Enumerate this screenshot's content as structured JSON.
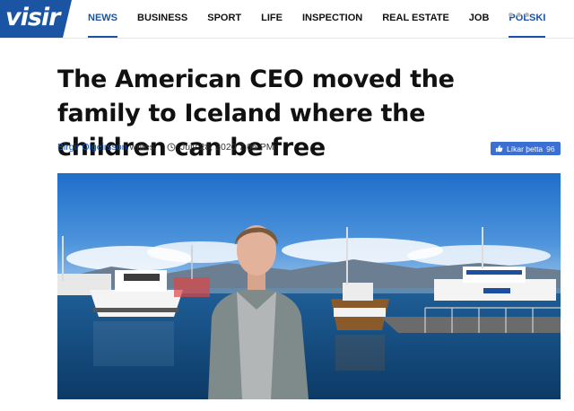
{
  "brand": {
    "logo_text": "visir",
    "color": "#1a54a3"
  },
  "nav": {
    "items": [
      {
        "label": "NEWS",
        "active": true
      },
      {
        "label": "BUSINESS"
      },
      {
        "label": "SPORT"
      },
      {
        "label": "LIFE"
      },
      {
        "label": "INSPECTION"
      },
      {
        "label": "REAL ESTATE"
      },
      {
        "label": "JOB"
      },
      {
        "label": "POLSKI"
      }
    ],
    "more_icon": "more-dots-icon"
  },
  "article": {
    "headline": "The American CEO moved the family to Iceland where the children can be free",
    "author": "Birgir Olgeirsson",
    "writes": "writes",
    "date": "July 28, 2020 7:05 PM",
    "like_label": "Líkar þetta",
    "like_count": "96",
    "photo_icon": "harbor-photo"
  }
}
